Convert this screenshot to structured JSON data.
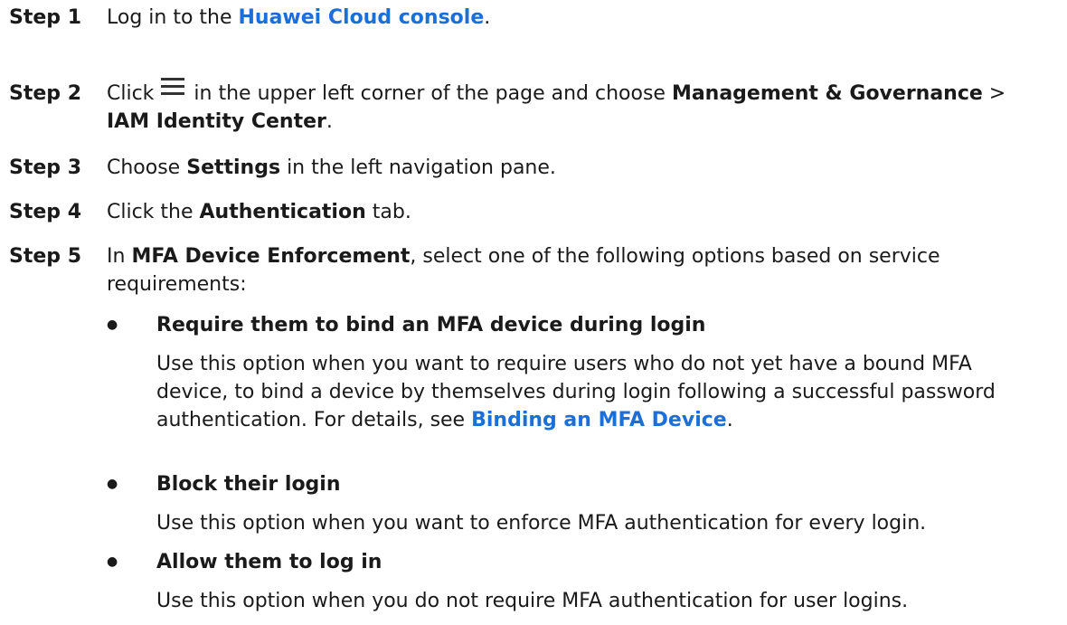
{
  "steps": [
    {
      "label": "Step 1",
      "text_before": "Log in to the ",
      "link": "Huawei Cloud console",
      "text_after": "."
    },
    {
      "label": "Step 2",
      "text_before": "Click",
      "icon": "menu-icon",
      "text_middle": "in the upper left corner of the page and choose ",
      "bold1": "Management & Governance",
      "sep": " > ",
      "bold2": "IAM Identity Center",
      "text_after": "."
    },
    {
      "label": "Step 3",
      "text_before": "Choose ",
      "bold": "Settings",
      "text_after": " in the left navigation pane."
    },
    {
      "label": "Step 4",
      "text_before": "Click the ",
      "bold": "Authentication",
      "text_after": " tab."
    },
    {
      "label": "Step 5",
      "text_before": "In ",
      "bold": "MFA Device Enforcement",
      "text_after": ", select one of the following options based on service requirements:"
    }
  ],
  "options": [
    {
      "bullet": "●",
      "title": "Require them to bind an MFA device during login",
      "desc_before": "Use this option when you want to require users who do not yet have a bound MFA device, to bind a device by themselves during login following a successful password authentication. For details, see ",
      "link": "Binding an MFA Device",
      "desc_after": "."
    },
    {
      "bullet": "●",
      "title": "Block their login",
      "desc": "Use this option when you want to enforce MFA authentication for every login."
    },
    {
      "bullet": "●",
      "title": "Allow them to log in",
      "desc": "Use this option when you do not require MFA authentication for user logins."
    }
  ]
}
